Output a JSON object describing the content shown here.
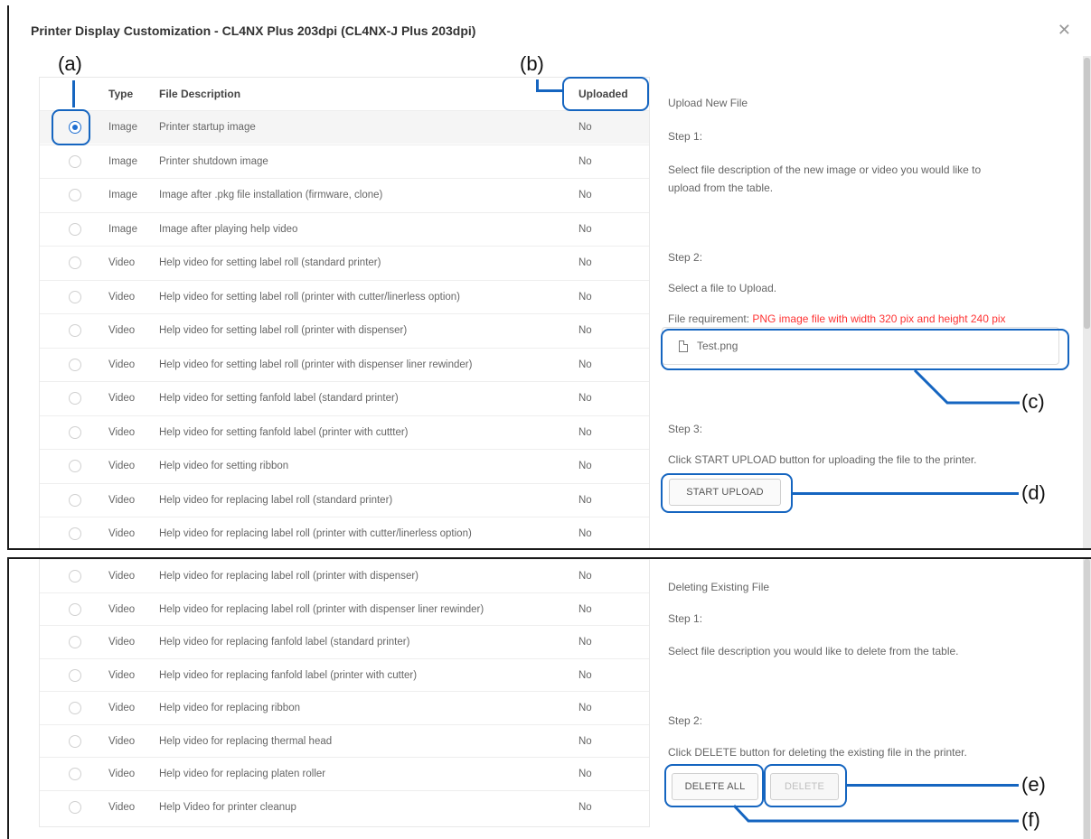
{
  "dialog": {
    "title": "Printer Display Customization - CL4NX Plus 203dpi (CL4NX-J Plus 203dpi)",
    "close_icon": "close-icon"
  },
  "table": {
    "headers": {
      "type": "Type",
      "description": "File Description",
      "uploaded": "Uploaded"
    },
    "rows_top": [
      {
        "type": "Image",
        "description": "Printer startup image",
        "uploaded": "No",
        "selected": true
      },
      {
        "type": "Image",
        "description": "Printer shutdown image",
        "uploaded": "No"
      },
      {
        "type": "Image",
        "description": "Image after .pkg file installation (firmware, clone)",
        "uploaded": "No"
      },
      {
        "type": "Image",
        "description": "Image after playing help video",
        "uploaded": "No"
      },
      {
        "type": "Video",
        "description": "Help video for setting label roll (standard printer)",
        "uploaded": "No"
      },
      {
        "type": "Video",
        "description": "Help video for setting label roll (printer with cutter/linerless option)",
        "uploaded": "No"
      },
      {
        "type": "Video",
        "description": "Help video for setting label roll (printer with dispenser)",
        "uploaded": "No"
      },
      {
        "type": "Video",
        "description": "Help video for setting label roll (printer with dispenser liner rewinder)",
        "uploaded": "No"
      },
      {
        "type": "Video",
        "description": "Help video for setting fanfold label (standard printer)",
        "uploaded": "No"
      },
      {
        "type": "Video",
        "description": "Help video for setting fanfold label (printer with cuttter)",
        "uploaded": "No"
      },
      {
        "type": "Video",
        "description": "Help video for setting ribbon",
        "uploaded": "No"
      },
      {
        "type": "Video",
        "description": "Help video for replacing label roll (standard printer)",
        "uploaded": "No"
      },
      {
        "type": "Video",
        "description": "Help video for replacing label roll (printer with cutter/linerless option)",
        "uploaded": "No"
      }
    ],
    "rows_bottom": [
      {
        "type": "Video",
        "description": "Help video for replacing label roll (printer with dispenser)",
        "uploaded": "No"
      },
      {
        "type": "Video",
        "description": "Help video for replacing label roll (printer with dispenser liner rewinder)",
        "uploaded": "No"
      },
      {
        "type": "Video",
        "description": "Help video for replacing fanfold label (standard printer)",
        "uploaded": "No"
      },
      {
        "type": "Video",
        "description": "Help video for replacing fanfold label (printer with cutter)",
        "uploaded": "No"
      },
      {
        "type": "Video",
        "description": "Help video for replacing ribbon",
        "uploaded": "No"
      },
      {
        "type": "Video",
        "description": "Help video for replacing thermal head",
        "uploaded": "No"
      },
      {
        "type": "Video",
        "description": "Help video for replacing platen roller",
        "uploaded": "No"
      },
      {
        "type": "Video",
        "description": "Help Video for printer cleanup",
        "uploaded": "No"
      }
    ]
  },
  "upload": {
    "heading": "Upload New File",
    "step1_label": "Step 1:",
    "step1_line1": "Select file description of the new image or video you would like to",
    "step1_line2": "upload from the table.",
    "step2_label": "Step 2:",
    "step2_text": "Select a file to Upload.",
    "requirement_label": "File requirement:",
    "requirement_value": "PNG image file with width 320 pix and height 240 pix",
    "file_name": "Test.png",
    "step3_label": "Step 3:",
    "step3_text": "Click START UPLOAD button for uploading the file to the printer.",
    "start_upload_label": "START UPLOAD"
  },
  "delete": {
    "heading": "Deleting Existing File",
    "step1_label": "Step 1:",
    "step1_text": "Select file description you would like to delete from the table.",
    "step2_label": "Step 2:",
    "step2_text": "Click DELETE button for deleting the existing file in the printer.",
    "delete_all_label": "DELETE ALL",
    "delete_label": "DELETE"
  },
  "annotations": {
    "a": "(a)",
    "b": "(b)",
    "c": "(c)",
    "d": "(d)",
    "e": "(e)",
    "f": "(f)",
    "accent_color": "#1565c0",
    "requirement_color": "#ff3333",
    "radio_color": "#1f6fd1"
  }
}
